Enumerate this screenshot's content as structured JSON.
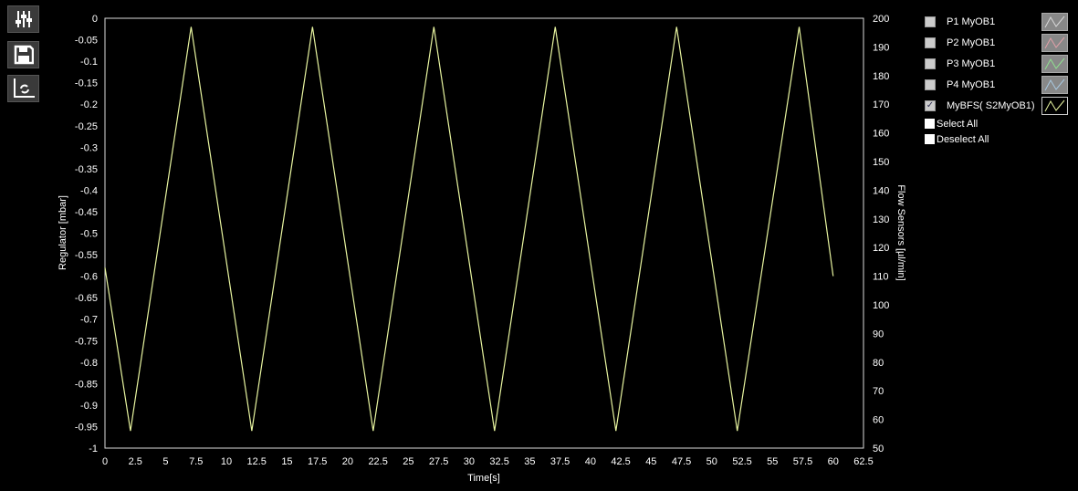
{
  "toolbar": {
    "icons": [
      "sliders-icon",
      "save-icon",
      "chart-refresh-icon"
    ]
  },
  "legend": {
    "items": [
      {
        "label": "P1 MyOB1",
        "checked": false,
        "color": "#d8d8d8"
      },
      {
        "label": "P2 MyOB1",
        "checked": false,
        "color": "#e0a0a8"
      },
      {
        "label": "P3 MyOB1",
        "checked": false,
        "color": "#90e090"
      },
      {
        "label": "P4 MyOB1",
        "checked": false,
        "color": "#a8c8e0"
      },
      {
        "label": "MyBFS( S2MyOB1)",
        "checked": true,
        "color": "#e8f5a0"
      }
    ],
    "select_all": "Select All",
    "deselect_all": "Deselect All"
  },
  "chart_data": {
    "type": "line",
    "xlabel": "Time[s]",
    "ylabel_left": "Regulator [mbar]",
    "ylabel_right": "Flow Sensors [µl/min]",
    "xlim": [
      0,
      62.5
    ],
    "ylim_left": [
      -1,
      0
    ],
    "ylim_right": [
      50,
      200
    ],
    "x_ticks": [
      "0",
      "2.5",
      "5",
      "7.5",
      "10",
      "12.5",
      "15",
      "17.5",
      "20",
      "22.5",
      "25",
      "27.5",
      "30",
      "32.5",
      "35",
      "37.5",
      "40",
      "42.5",
      "45",
      "47.5",
      "50",
      "52.5",
      "55",
      "57.5",
      "60",
      "62.5"
    ],
    "y_left_ticks": [
      "0",
      "-0.05",
      "-0.1",
      "-0.15",
      "-0.2",
      "-0.25",
      "-0.3",
      "-0.35",
      "-0.4",
      "-0.45",
      "-0.5",
      "-0.55",
      "-0.6",
      "-0.65",
      "-0.7",
      "-0.75",
      "-0.8",
      "-0.85",
      "-0.9",
      "-0.95",
      "-1"
    ],
    "y_right_ticks": [
      "200",
      "190",
      "180",
      "170",
      "160",
      "150",
      "140",
      "130",
      "120",
      "110",
      "100",
      "90",
      "80",
      "70",
      "60",
      "50"
    ],
    "grid": false,
    "series": [
      {
        "name": "MyBFS( S2MyOB1)",
        "axis": "right",
        "color": "#e8f5a0",
        "x": [
          0,
          2.1,
          7.1,
          12.1,
          17.1,
          22.1,
          27.1,
          32.1,
          37.1,
          42.1,
          47.1,
          52.1,
          57.2,
          60
        ],
        "y": [
          113,
          56,
          197,
          56,
          197,
          56,
          197,
          56,
          197,
          56,
          197,
          56,
          197,
          110
        ]
      }
    ]
  }
}
